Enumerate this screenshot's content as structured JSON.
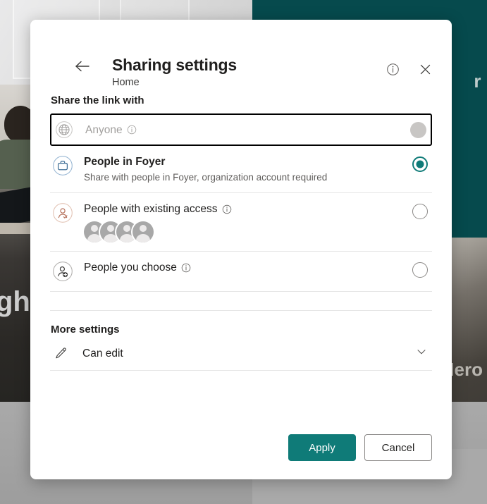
{
  "background": {
    "teal_text": "r",
    "left_photo_text": "ght",
    "hero_text": "Hero"
  },
  "dialog": {
    "title": "Sharing settings",
    "subtitle": "Home",
    "back_label": "Back",
    "info_label": "Info",
    "close_label": "Close",
    "share_section_label": "Share the link with",
    "more_section_label": "More settings",
    "options": [
      {
        "id": "anyone",
        "icon": "globe-icon",
        "title": "Anyone",
        "desc": "",
        "has_info": true,
        "state": "disabled-focused",
        "selected": false
      },
      {
        "id": "people-in-foyer",
        "icon": "briefcase-icon",
        "title": "People in Foyer",
        "desc": "Share with people in Foyer, organization account required",
        "has_info": false,
        "state": "normal",
        "selected": true
      },
      {
        "id": "people-with-existing-access",
        "icon": "person-check-icon",
        "title": "People with existing access",
        "desc": "",
        "has_info": true,
        "state": "normal",
        "selected": false,
        "avatar_count": 4
      },
      {
        "id": "people-you-choose",
        "icon": "person-add-icon",
        "title": "People you choose",
        "desc": "",
        "has_info": true,
        "state": "normal",
        "selected": false
      }
    ],
    "permission": {
      "icon": "pencil-icon",
      "value": "Can edit",
      "chevron": "chevron-down-icon"
    },
    "footer": {
      "apply_label": "Apply",
      "cancel_label": "Cancel"
    }
  },
  "colors": {
    "accent_teal": "#0f7b78",
    "panel_teal": "#064a4d",
    "text_primary": "#201f1e",
    "text_secondary": "#605e5c",
    "disabled_text": "#a19f9d",
    "divider": "#e6e6e6",
    "focus_ring": "#000000"
  }
}
